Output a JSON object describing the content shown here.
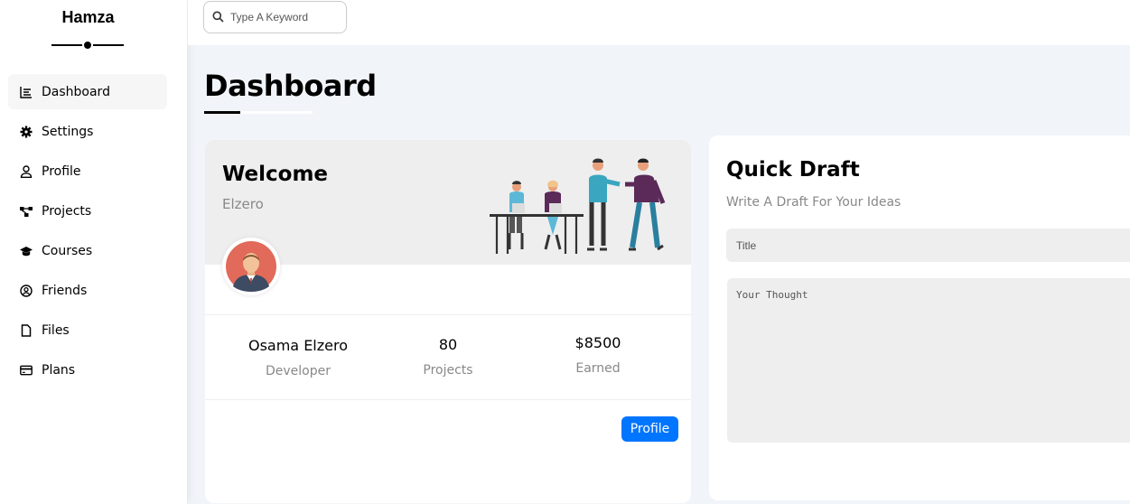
{
  "sidebar": {
    "brand": "Hamza",
    "items": [
      {
        "label": "Dashboard",
        "icon": "chart-icon",
        "active": true
      },
      {
        "label": "Settings",
        "icon": "gear-icon"
      },
      {
        "label": "Profile",
        "icon": "user-icon"
      },
      {
        "label": "Projects",
        "icon": "diagram-icon"
      },
      {
        "label": "Courses",
        "icon": "graduation-cap-icon"
      },
      {
        "label": "Friends",
        "icon": "circle-user-icon"
      },
      {
        "label": "Files",
        "icon": "file-icon"
      },
      {
        "label": "Plans",
        "icon": "credit-card-icon"
      }
    ]
  },
  "header": {
    "search_placeholder": "Type A Keyword"
  },
  "page": {
    "title": "Dashboard"
  },
  "welcome": {
    "heading": "Welcome",
    "subheading": "Elzero",
    "stats": [
      {
        "value": "Osama Elzero",
        "label": "Developer"
      },
      {
        "value": "80",
        "label": "Projects"
      },
      {
        "value": "$8500",
        "label": "Earned"
      }
    ],
    "button_label": "Profile"
  },
  "quick_draft": {
    "title": "Quick Draft",
    "subtitle": "Write A Draft For Your Ideas",
    "title_placeholder": "Title",
    "thought_placeholder": "Your Thought"
  },
  "colors": {
    "accent": "#0075ff",
    "page_bg": "#f1f5f9",
    "card_header_bg": "#eeeeee"
  }
}
